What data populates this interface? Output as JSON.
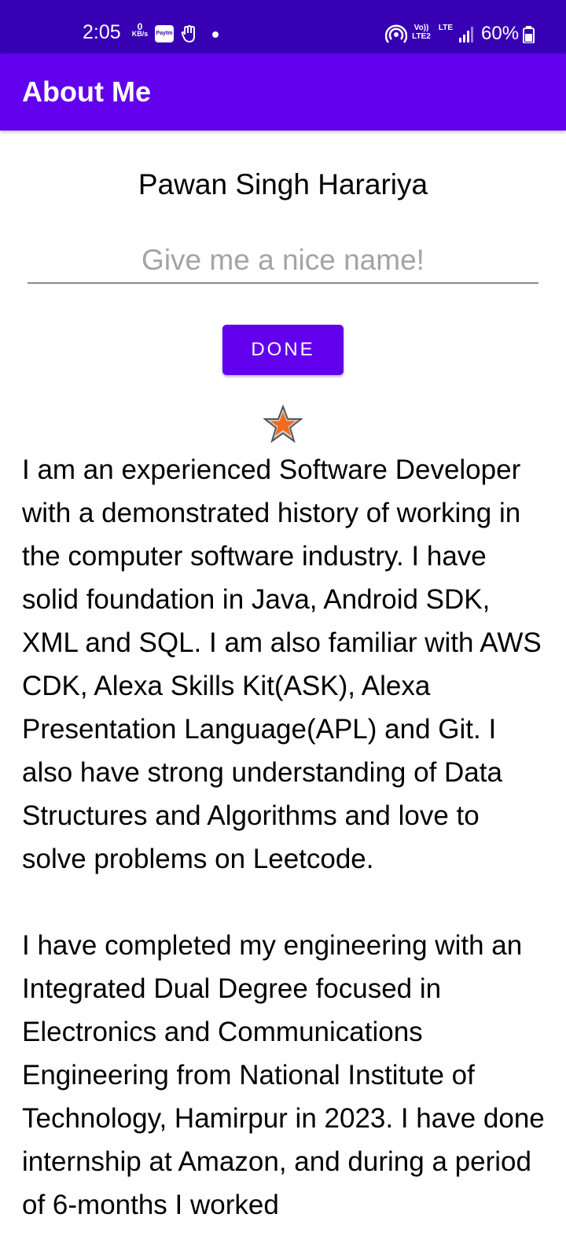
{
  "status_bar": {
    "time": "2:05",
    "speed_value": "0",
    "speed_unit": "KB/s",
    "paytm_label": "Paytm",
    "volte_label": "Vo)) LTE2",
    "lte_label": "LTE",
    "battery": "60%",
    "icons": [
      "paytm-icon",
      "hand-icon",
      "dot-icon",
      "hotspot-icon",
      "volte-icon",
      "lte-icon",
      "signal-icon",
      "battery-icon"
    ],
    "color": "#3700b3"
  },
  "app_bar": {
    "title": "About Me",
    "color": "#6200ee"
  },
  "profile": {
    "name": "Pawan Singh Harariya"
  },
  "nickname": {
    "value": "",
    "placeholder": "Give me a nice name!"
  },
  "done_button": {
    "label": "DONE"
  },
  "star": {
    "icon": "star-icon",
    "color": "#f26b1d"
  },
  "bio": {
    "text": "I am an experienced Software Developer with a demonstrated history of working in the computer software industry. I have solid foundation in Java, Android SDK, XML and SQL. I am also familiar with AWS CDK, Alexa Skills Kit(ASK), Alexa Presentation Language(APL) and Git. I also have strong understanding of Data Structures and Algorithms and love to solve problems on Leetcode.\n\nI have completed my engineering with an Integrated Dual Degree focused in Electronics and Communications Engineering from National Institute of Technology, Hamirpur in 2023. I have done internship at Amazon, and during a period of 6-months I worked"
  }
}
